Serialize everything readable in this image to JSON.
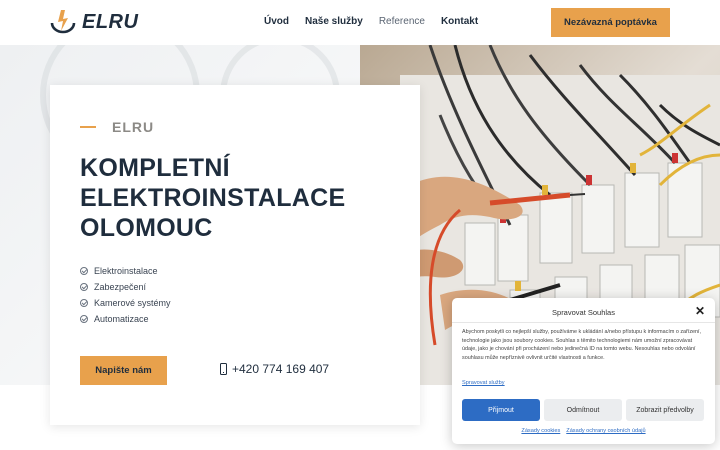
{
  "header": {
    "logo_text": "ELRU",
    "nav": [
      "Úvod",
      "Naše služby",
      "Reference",
      "Kontakt"
    ],
    "cta": "Nezávazná poptávka"
  },
  "hero": {
    "kicker": "ELRU",
    "headline_lines": [
      "KOMPLETNÍ",
      "ELEKTROINSTALACE",
      "OLOMOUC"
    ],
    "features": [
      "Elektroinstalace",
      "Zabezpečení",
      "Kamerové systémy",
      "Automatizace"
    ],
    "button": "Napište nám",
    "phone": "+420 774 169 407"
  },
  "consent": {
    "title": "Spravovat Souhlas",
    "body": "Abychom poskytli co nejlepší služby, používáme k ukládání a/nebo přístupu k informacím o zařízení, technologie jako jsou soubory cookies. Souhlas s těmito technologiemi nám umožní zpracovávat údaje, jako je chování při procházení nebo jedinečná ID na tomto webu. Nesouhlas nebo odvolání souhlasu může nepříznivě ovlivnit určité vlastnosti a funkce.",
    "manage_link": "Spravovat služby",
    "accept": "Přijmout",
    "deny": "Odmítnout",
    "preferences": "Zobrazit předvolby",
    "footer_links": [
      "Zásady cookies",
      "Zásady ochrany osobních údajů"
    ]
  },
  "colors": {
    "accent": "#e8a14c",
    "dark": "#1f2d3d",
    "consent_blue": "#2d6cc4"
  }
}
